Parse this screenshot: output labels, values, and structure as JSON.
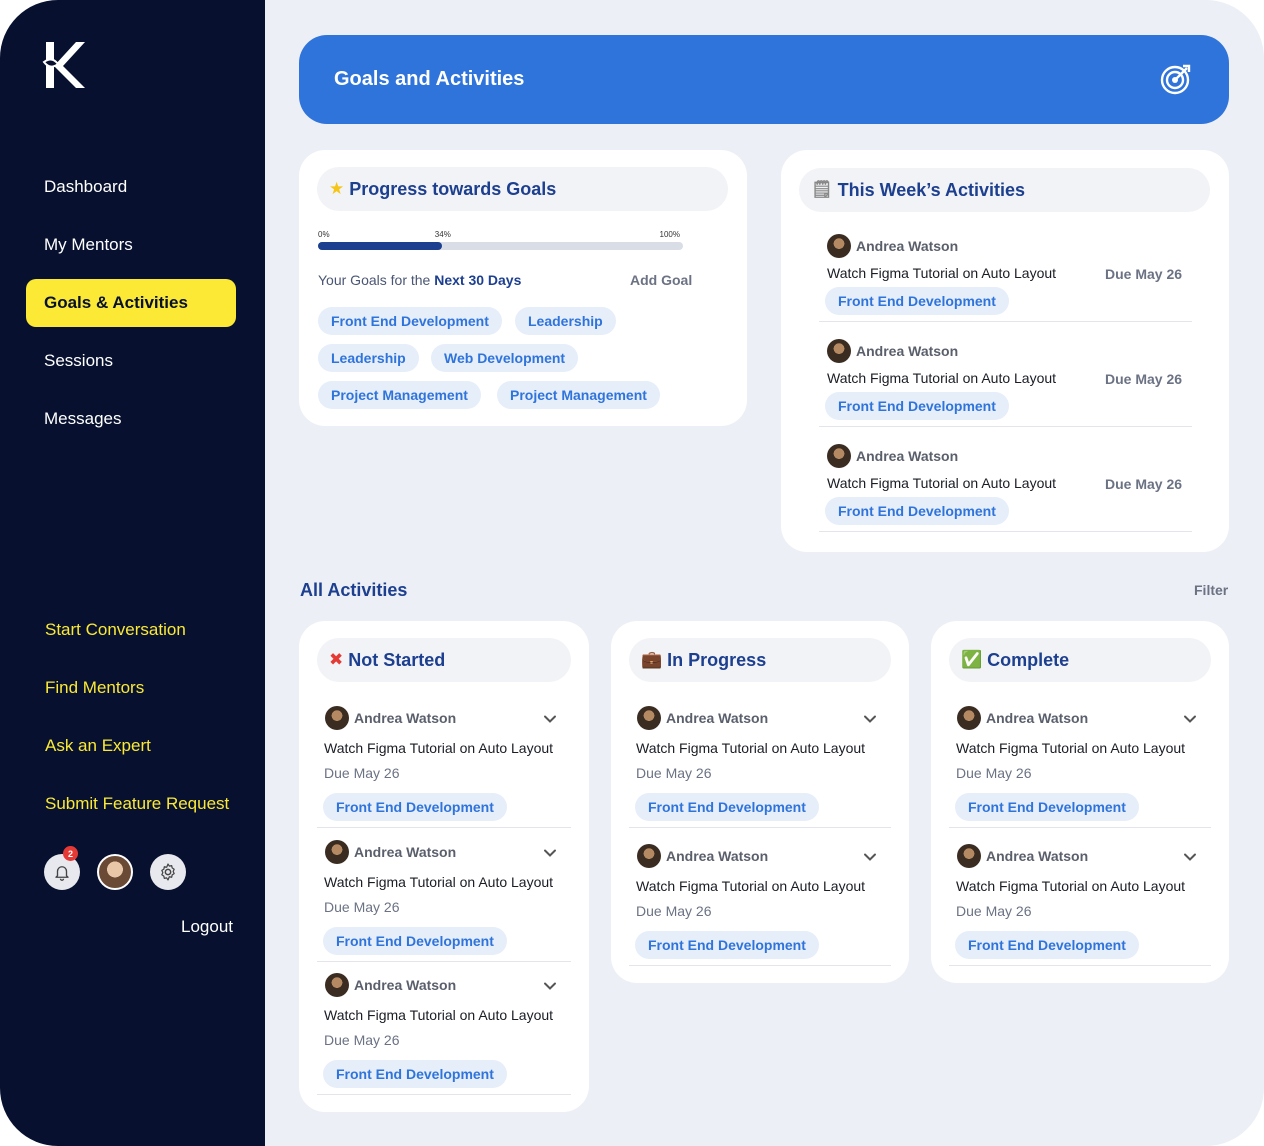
{
  "sidebar": {
    "logo": "K",
    "nav": [
      {
        "label": "Dashboard"
      },
      {
        "label": "My Mentors"
      },
      {
        "label": "Goals & Activities"
      },
      {
        "label": "Sessions"
      },
      {
        "label": "Messages"
      }
    ],
    "links": [
      {
        "label": "Start Conversation"
      },
      {
        "label": "Find Mentors"
      },
      {
        "label": "Ask an Expert"
      },
      {
        "label": "Submit Feature Request"
      }
    ],
    "notification_count": "2",
    "logout": "Logout"
  },
  "header": {
    "title": "Goals and Activities",
    "icon": "target-icon"
  },
  "progress_card": {
    "title": "Progress towards Goals",
    "progress_percent": 34,
    "ticks": {
      "start": "0%",
      "mid": "34%",
      "end": "100%"
    },
    "goals_prefix": "Your Goals for the ",
    "goals_highlight": "Next 30 Days",
    "add_goal": "Add Goal",
    "chips": [
      "Front End Development",
      "Leadership",
      "Leadership",
      "Web Development",
      "Project Management",
      "Project Management"
    ]
  },
  "week_card": {
    "title": "This Week’s Activities",
    "items": [
      {
        "name": "Andrea Watson",
        "task": "Watch Figma Tutorial on Auto Layout",
        "due": "Due May 26",
        "tag": "Front End Development"
      },
      {
        "name": "Andrea Watson",
        "task": "Watch Figma Tutorial on Auto Layout",
        "due": "Due May 26",
        "tag": "Front End Development"
      },
      {
        "name": "Andrea Watson",
        "task": "Watch Figma Tutorial on Auto Layout",
        "due": "Due May 26",
        "tag": "Front End Development"
      }
    ]
  },
  "all_activities": {
    "title": "All Activities",
    "filter": "Filter",
    "columns": [
      {
        "title": "Not Started",
        "items": [
          {
            "name": "Andrea Watson",
            "task": "Watch Figma Tutorial on Auto Layout",
            "due": "Due May 26",
            "tag": "Front End Development"
          },
          {
            "name": "Andrea Watson",
            "task": "Watch Figma Tutorial on Auto Layout",
            "due": "Due May 26",
            "tag": "Front End Development"
          },
          {
            "name": "Andrea Watson",
            "task": "Watch Figma Tutorial on Auto Layout",
            "due": "Due May 26",
            "tag": "Front End Development"
          }
        ]
      },
      {
        "title": "In Progress",
        "items": [
          {
            "name": "Andrea Watson",
            "task": "Watch Figma Tutorial on Auto Layout",
            "due": "Due May 26",
            "tag": "Front End Development"
          },
          {
            "name": "Andrea Watson",
            "task": "Watch Figma Tutorial on Auto Layout",
            "due": "Due May 26",
            "tag": "Front End Development"
          }
        ]
      },
      {
        "title": "Complete",
        "items": [
          {
            "name": "Andrea Watson",
            "task": "Watch Figma Tutorial on Auto Layout",
            "due": "Due May 26",
            "tag": "Front End Development"
          },
          {
            "name": "Andrea Watson",
            "task": "Watch Figma Tutorial on Auto Layout",
            "due": "Due May 26",
            "tag": "Front End Development"
          }
        ]
      }
    ]
  },
  "colors": {
    "sidebar": "#07112f",
    "accent": "#fbe935",
    "primary": "#2f74db",
    "heading": "#1d3f8f"
  }
}
